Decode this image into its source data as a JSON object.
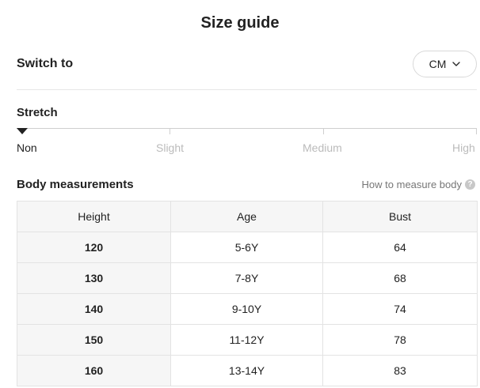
{
  "header": {
    "title": "Size guide"
  },
  "switch": {
    "label": "Switch to",
    "unit": "CM",
    "unit_icon": "chevron-down-icon"
  },
  "stretch": {
    "label": "Stretch",
    "levels": [
      "Non",
      "Slight",
      "Medium",
      "High"
    ],
    "selected": "Non"
  },
  "measurements": {
    "title": "Body measurements",
    "how_to_link": "How to measure body",
    "help_glyph": "?",
    "columns": [
      "Height",
      "Age",
      "Bust"
    ],
    "rows": [
      [
        "120",
        "5-6Y",
        "64"
      ],
      [
        "130",
        "7-8Y",
        "68"
      ],
      [
        "140",
        "9-10Y",
        "74"
      ],
      [
        "150",
        "11-12Y",
        "78"
      ],
      [
        "160",
        "13-14Y",
        "83"
      ]
    ]
  },
  "colors": {
    "text": "#222222",
    "muted": "#bbbbbb",
    "border": "#e3e3e3",
    "header_bg": "#f6f6f6"
  }
}
